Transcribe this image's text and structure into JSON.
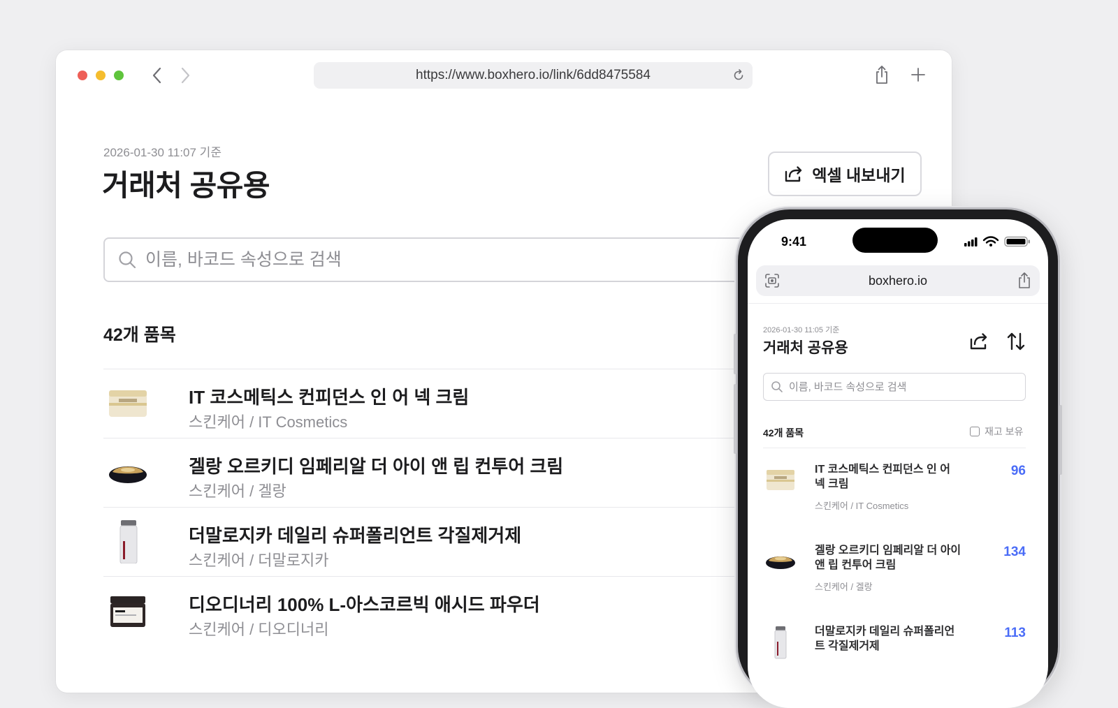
{
  "desktop": {
    "url": "https://www.boxhero.io/link/6dd8475584",
    "timestamp": "2026-01-30 11:07 기준",
    "title": "거래처 공유용",
    "export_label": "엑셀 내보내기",
    "search_placeholder": "이름, 바코드 속성으로 검색",
    "item_count": "42개 품목",
    "items": [
      {
        "name": "IT 코스메틱스 컨피던스 인 어 넥 크림",
        "category": "스킨케어 / IT Cosmetics"
      },
      {
        "name": "겔랑 오르키디 임페리알 더 아이 앤 립 컨투어 크림",
        "category": "스킨케어 / 겔랑"
      },
      {
        "name": "더말로지카 데일리 슈퍼폴리언트 각질제거제",
        "category": "스킨케어 / 더말로지카"
      },
      {
        "name": "디오디너리 100% L-아스코르빅 애시드 파우더",
        "category": "스킨케어 / 디오디너리"
      }
    ]
  },
  "mobile": {
    "status_time": "9:41",
    "url": "boxhero.io",
    "timestamp": "2026-01-30 11:05 기준",
    "title": "거래처 공유용",
    "search_placeholder": "이름, 바코드 속성으로 검색",
    "item_count": "42개 품목",
    "stock_filter_label": "재고 보유",
    "items": [
      {
        "name": "IT 코스메틱스 컨피던스 인 어 넥 크림",
        "category": "스킨케어 / IT Cosmetics",
        "quantity": "96"
      },
      {
        "name": "겔랑 오르키디 임페리알 더 아이 앤 립 컨투어 크림",
        "category": "스킨케어 / 겔랑",
        "quantity": "134"
      },
      {
        "name": "더말로지카 데일리 슈퍼폴리언트 각질제거제",
        "category": "",
        "quantity": "113"
      }
    ]
  },
  "colors": {
    "accent": "#4a6cf7",
    "muted": "#8e8e93",
    "text": "#1c1c1e"
  }
}
